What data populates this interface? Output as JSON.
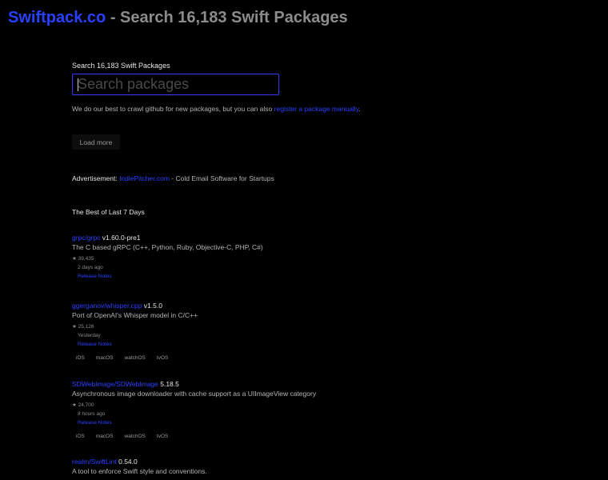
{
  "header": {
    "brand": "Swiftpack.co",
    "title_rest": " - Search 16,183 Swift Packages"
  },
  "search": {
    "label": "Search 16,183 Swift Packages",
    "placeholder": "Search packages",
    "value": ""
  },
  "crawl_note": {
    "text": "We do our best to crawl github for new packages, but you can also ",
    "link": "register a package manually",
    "end": "."
  },
  "load_more": {
    "label": "Load more"
  },
  "ad": {
    "label": "Advertisement: ",
    "link": "IndiePitcher.com",
    "rest": " - Cold Email Software for Startups"
  },
  "best": {
    "heading": "The Best of Last 7 Days"
  },
  "packages": [
    {
      "name": "grpc/grpc",
      "version": " v1.60.0-pre1",
      "desc": "The C based gRPC (C++, Python, Ruby, Objective-C, PHP, C#)",
      "stars": "★ 39,435",
      "time": "2 days ago",
      "release": "Release Notes",
      "platforms": []
    },
    {
      "name": "ggerganov/whisper.cpp",
      "version": " v1.5.0",
      "desc": "Port of OpenAI's Whisper model in C/C++",
      "stars": "★ 25,126",
      "time": "Yesterday",
      "release": "Release Notes",
      "platforms": [
        "iOS",
        "macOS",
        "watchOS",
        "tvOS"
      ]
    },
    {
      "name": "SDWebImage/SDWebImage",
      "version": " 5.18.5",
      "desc": "Asynchronous image downloader with cache support as a UIImageView category",
      "stars": "★ 24,700",
      "time": "8 hours ago",
      "release": "Release Notes",
      "platforms": [
        "iOS",
        "macOS",
        "watchOS",
        "tvOS"
      ]
    },
    {
      "name": "realm/SwiftLint",
      "version": " 0.54.0",
      "desc": "A tool to enforce Swift style and conventions.",
      "stars": "",
      "time": "",
      "release": "",
      "platforms": []
    }
  ]
}
